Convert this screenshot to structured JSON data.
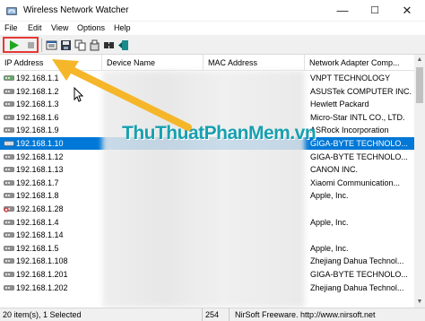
{
  "window": {
    "title": "Wireless Network Watcher",
    "minimize": "—",
    "maximize": "☐",
    "close": "✕"
  },
  "menu": [
    "File",
    "Edit",
    "View",
    "Options",
    "Help"
  ],
  "toolbar": {
    "icons": [
      "play-icon",
      "stop-icon",
      "properties-icon",
      "save-icon",
      "copy-icon",
      "report-icon",
      "find-icon",
      "exit-icon"
    ]
  },
  "columns": [
    "IP Address",
    "Device Name",
    "MAC Address",
    "Network Adapter Comp..."
  ],
  "rows": [
    {
      "ip": "192.168.1.1",
      "vendor": "VNPT TECHNOLOGY",
      "selected": false,
      "icon": "router"
    },
    {
      "ip": "192.168.1.2",
      "vendor": "ASUSTek COMPUTER INC.",
      "selected": false,
      "icon": "computer"
    },
    {
      "ip": "192.168.1.3",
      "vendor": "Hewlett Packard",
      "selected": false,
      "icon": "computer"
    },
    {
      "ip": "192.168.1.6",
      "vendor": "Micro-Star INTL CO., LTD.",
      "selected": false,
      "icon": "computer"
    },
    {
      "ip": "192.168.1.9",
      "vendor": "ASRock Incorporation",
      "selected": false,
      "icon": "computer"
    },
    {
      "ip": "192.168.1.10",
      "vendor": "GIGA-BYTE TECHNOLO...",
      "selected": true,
      "icon": "computer-own"
    },
    {
      "ip": "192.168.1.12",
      "vendor": "GIGA-BYTE TECHNOLO...",
      "selected": false,
      "icon": "computer"
    },
    {
      "ip": "192.168.1.13",
      "vendor": "CANON INC.",
      "selected": false,
      "icon": "computer"
    },
    {
      "ip": "192.168.1.7",
      "vendor": "Xiaomi Communication...",
      "selected": false,
      "icon": "computer"
    },
    {
      "ip": "192.168.1.8",
      "vendor": "Apple, Inc.",
      "selected": false,
      "icon": "computer"
    },
    {
      "ip": "192.168.1.28",
      "vendor": "",
      "selected": false,
      "icon": "computer-error"
    },
    {
      "ip": "192.168.1.4",
      "vendor": "Apple, Inc.",
      "selected": false,
      "icon": "computer"
    },
    {
      "ip": "192.168.1.14",
      "vendor": "",
      "selected": false,
      "icon": "computer"
    },
    {
      "ip": "192.168.1.5",
      "vendor": "Apple, Inc.",
      "selected": false,
      "icon": "computer"
    },
    {
      "ip": "192.168.1.108",
      "vendor": "Zhejiang Dahua Technol...",
      "selected": false,
      "icon": "computer"
    },
    {
      "ip": "192.168.1.201",
      "vendor": "GIGA-BYTE TECHNOLO...",
      "selected": false,
      "icon": "computer"
    },
    {
      "ip": "192.168.1.202",
      "vendor": "Zhejiang Dahua Technol...",
      "selected": false,
      "icon": "computer"
    }
  ],
  "watermark": "ThuThuatPhanMem.vn",
  "status": {
    "items": "20 item(s), 1 Selected",
    "count": "254",
    "brand": "NirSoft Freeware.  http://www.nirsoft.net"
  },
  "colors": {
    "selection": "#0078d7",
    "highlight_box": "#e53935",
    "arrow": "#f5b62a",
    "watermark": "#17a0b0"
  }
}
